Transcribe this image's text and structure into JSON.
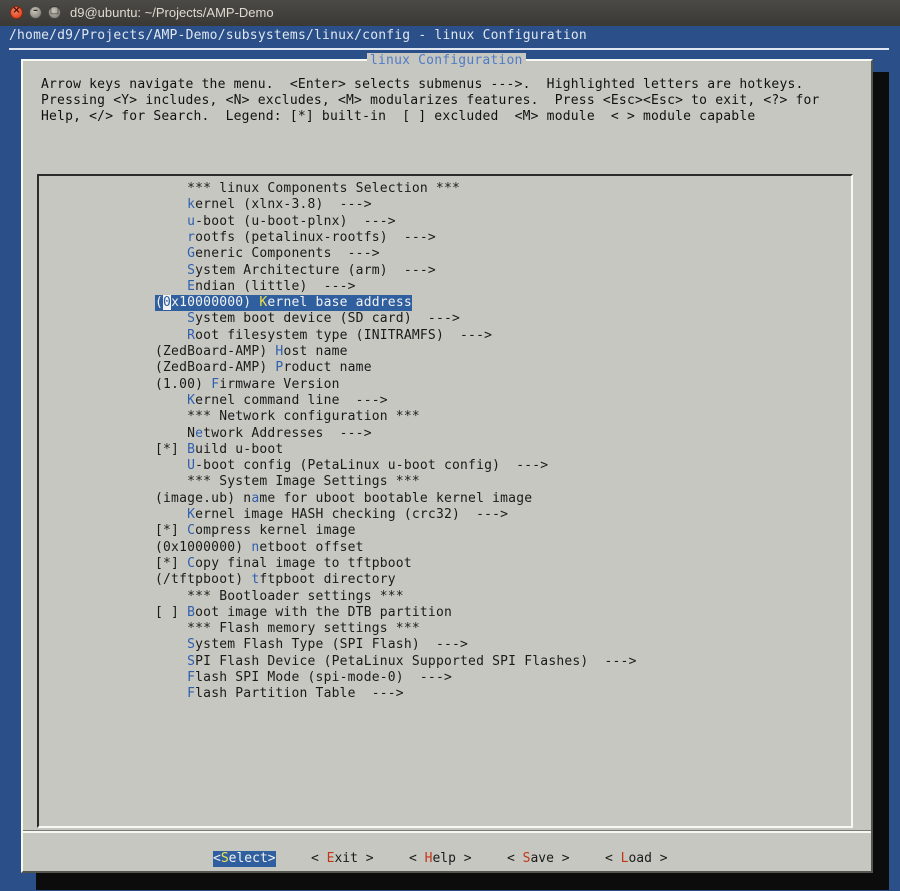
{
  "window": {
    "title": "d9@ubuntu: ~/Projects/AMP-Demo",
    "close_glyph": "×",
    "minimize_glyph": "–",
    "maximize_glyph": "□"
  },
  "terminal_header": "/home/d9/Projects/AMP-Demo/subsystems/linux/config - linux Configuration",
  "dialog": {
    "title": "linux Configuration",
    "help_lines": [
      "Arrow keys navigate the menu.  <Enter> selects submenus --->.  Highlighted letters are hotkeys.",
      "Pressing <Y> includes, <N> excludes, <M> modularizes features.  Press <Esc><Esc> to exit, <?> for",
      "Help, </> for Search.  Legend: [*] built-in  [ ] excluded  <M> module  < > module capable"
    ]
  },
  "menu_items": [
    {
      "pre": "    *** linux Components Selection ***",
      "hk": "",
      "post": ""
    },
    {
      "pre": "    ",
      "hk": "k",
      "post": "ernel (xlnx-3.8)  --->"
    },
    {
      "pre": "    ",
      "hk": "u",
      "post": "-boot (u-boot-plnx)  --->"
    },
    {
      "pre": "    ",
      "hk": "r",
      "post": "ootfs (petalinux-rootfs)  --->"
    },
    {
      "pre": "    ",
      "hk": "G",
      "post": "eneric Components  --->"
    },
    {
      "pre": "    ",
      "hk": "S",
      "post": "ystem Architecture (arm)  --->"
    },
    {
      "pre": "    ",
      "hk": "E",
      "post": "ndian (little)  --->"
    },
    {
      "pre": "(",
      "cur": "0",
      "mid": "x10000000) ",
      "hk": "K",
      "post": "ernel base address",
      "selected": true
    },
    {
      "pre": "    ",
      "hk": "S",
      "post": "ystem boot device (SD card)  --->"
    },
    {
      "pre": "    ",
      "hk": "R",
      "post": "oot filesystem type (INITRAMFS)  --->"
    },
    {
      "pre": "(ZedBoard-AMP) ",
      "hk": "H",
      "post": "ost name"
    },
    {
      "pre": "(ZedBoard-AMP) ",
      "hk": "P",
      "post": "roduct name"
    },
    {
      "pre": "(1.00) ",
      "hk": "F",
      "post": "irmware Version"
    },
    {
      "pre": "    ",
      "hk": "K",
      "post": "ernel command line  --->"
    },
    {
      "pre": "    *** Network configuration ***",
      "hk": "",
      "post": ""
    },
    {
      "pre": "    N",
      "hk": "e",
      "post": "twork Addresses  --->"
    },
    {
      "pre": "[*] ",
      "hk": "B",
      "post": "uild u-boot"
    },
    {
      "pre": "    ",
      "hk": "U",
      "post": "-boot config (PetaLinux u-boot config)  --->"
    },
    {
      "pre": "    *** System Image Settings ***",
      "hk": "",
      "post": ""
    },
    {
      "pre": "(image.ub) n",
      "hk": "a",
      "post": "me for uboot bootable kernel image"
    },
    {
      "pre": "    ",
      "hk": "K",
      "post": "ernel image HASH checking (crc32)  --->"
    },
    {
      "pre": "[*] ",
      "hk": "C",
      "post": "ompress kernel image"
    },
    {
      "pre": "(0x1000000) ",
      "hk": "n",
      "post": "etboot offset"
    },
    {
      "pre": "[*] ",
      "hk": "C",
      "post": "opy final image to tftpboot"
    },
    {
      "pre": "(/tftpboot) ",
      "hk": "t",
      "post": "ftpboot directory"
    },
    {
      "pre": "    *** Bootloader settings ***",
      "hk": "",
      "post": ""
    },
    {
      "pre": "[ ] ",
      "hk": "B",
      "post": "oot image with the DTB partition"
    },
    {
      "pre": "    *** Flash memory settings ***",
      "hk": "",
      "post": ""
    },
    {
      "pre": "    ",
      "hk": "S",
      "post": "ystem Flash Type (SPI Flash)  --->"
    },
    {
      "pre": "    ",
      "hk": "S",
      "post": "PI Flash Device (PetaLinux Supported SPI Flashes)  --->"
    },
    {
      "pre": "    ",
      "hk": "F",
      "post": "lash SPI Mode (spi-mode-0)  --->"
    },
    {
      "pre": "    ",
      "hk": "F",
      "post": "lash Partition Table  --->"
    }
  ],
  "buttons": [
    {
      "pre": "<",
      "hk": "S",
      "post": "elect>",
      "active": true
    },
    {
      "pre": "< ",
      "hk": "E",
      "post": "xit >"
    },
    {
      "pre": "< ",
      "hk": "H",
      "post": "elp >"
    },
    {
      "pre": "< ",
      "hk": "S",
      "post": "ave >"
    },
    {
      "pre": "< ",
      "hk": "L",
      "post": "oad >"
    }
  ],
  "colors": {
    "terminal_bg": "#2b4f88",
    "dialog_bg": "#c7c7c1",
    "highlight": "#2f5f9f",
    "hotkey": "#2f5faf",
    "button_hotkey": "#c23616"
  }
}
